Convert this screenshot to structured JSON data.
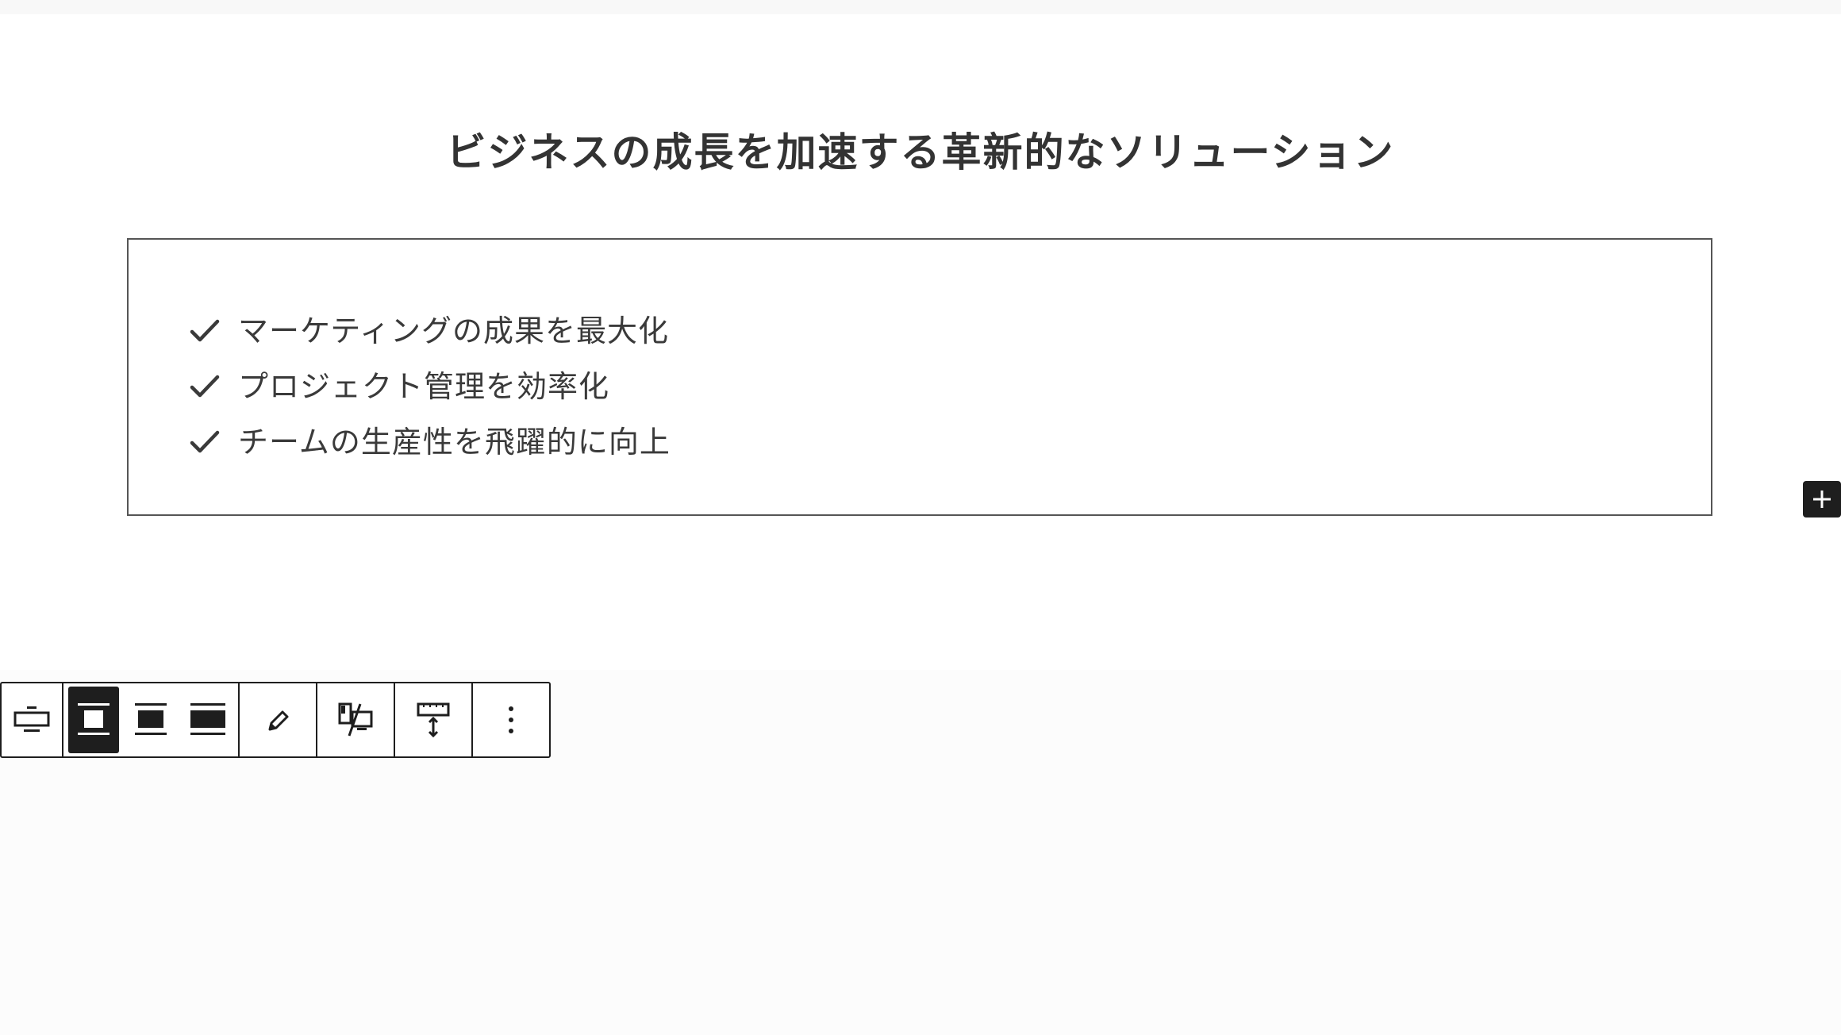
{
  "heading": "ビジネスの成長を加速する革新的なソリューション",
  "features": [
    "マーケティングの成果を最大化",
    "プロジェクト管理を効率化",
    "チームの生産性を飛躍的に向上"
  ],
  "toolbar": {
    "buttons": [
      {
        "name": "block-type-icon",
        "active": false
      },
      {
        "name": "align-none-icon",
        "active": true
      },
      {
        "name": "align-wide-icon",
        "active": false
      },
      {
        "name": "align-full-icon",
        "active": false
      },
      {
        "name": "edit-pencil-icon",
        "active": false
      },
      {
        "name": "hide-on-device-icon",
        "active": false
      },
      {
        "name": "height-adjust-icon",
        "active": false
      },
      {
        "name": "more-options-icon",
        "active": false
      }
    ]
  },
  "colors": {
    "text": "#333333",
    "border": "#555555",
    "toolbar_dark": "#1e1e1e",
    "lower_bg": "#fcfcfc"
  }
}
